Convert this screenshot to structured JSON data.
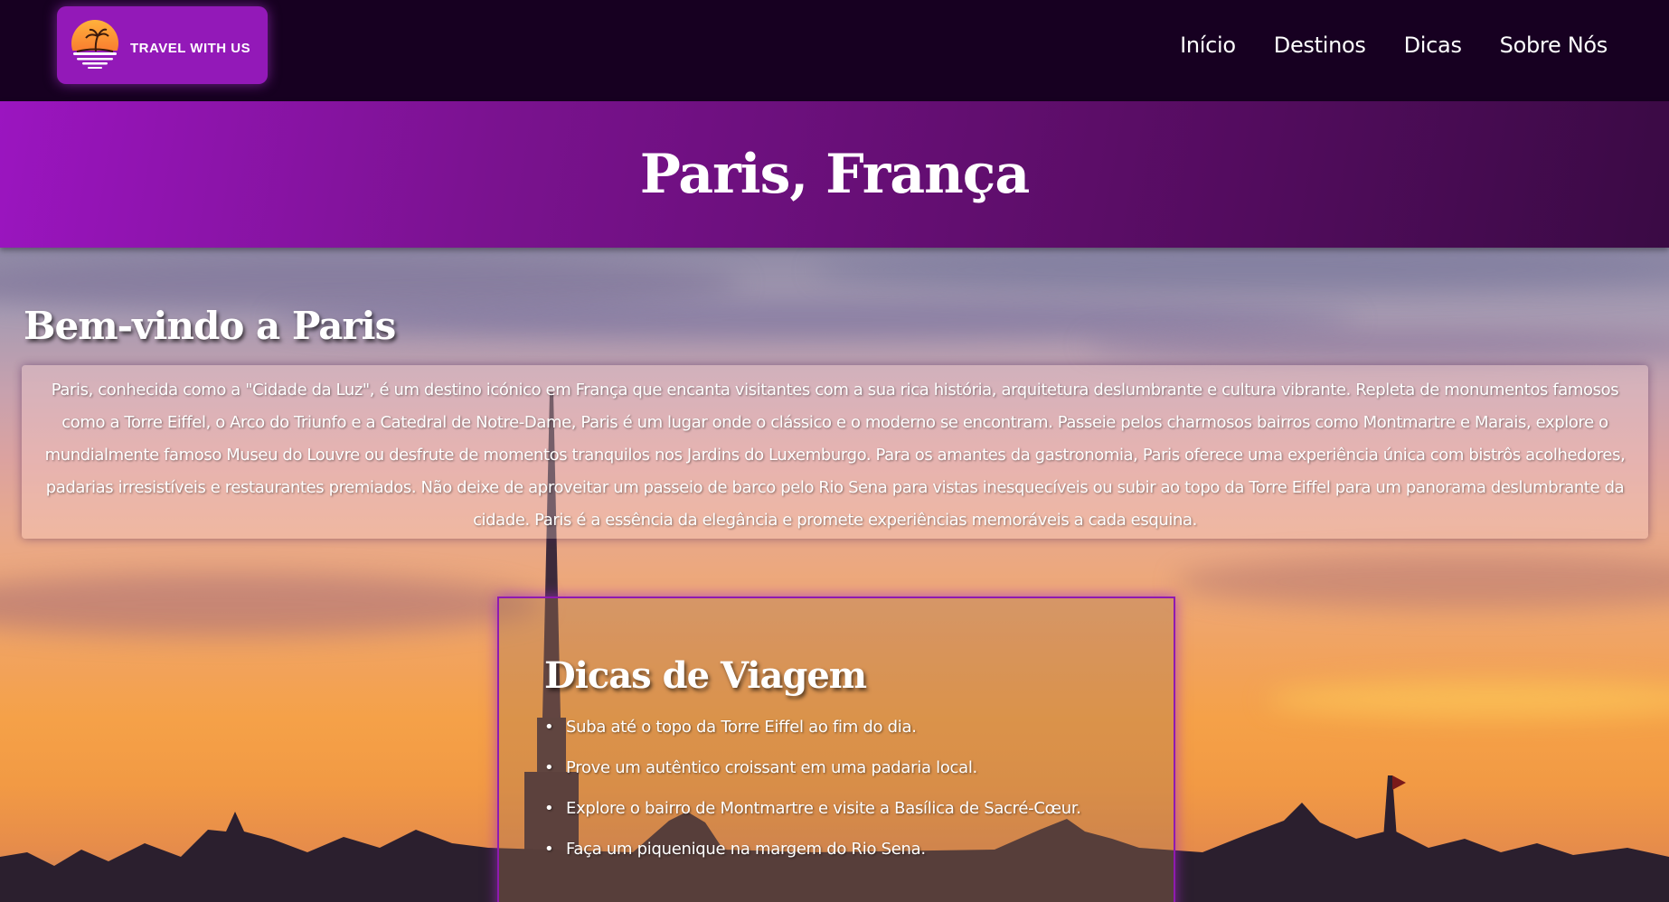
{
  "navbar": {
    "logo_text": "TRAVEL WITH US",
    "links": [
      {
        "label": "Início"
      },
      {
        "label": "Destinos"
      },
      {
        "label": "Dicas"
      },
      {
        "label": "Sobre Nós"
      }
    ]
  },
  "hero": {
    "title": "Paris, França"
  },
  "welcome": {
    "title": "Bem-vindo a Paris",
    "text": "Paris, conhecida como a \"Cidade da Luz\", é um destino icónico em França que encanta visitantes com a sua rica história, arquitetura deslumbrante e cultura vibrante. Repleta de monumentos famosos como a Torre Eiffel, o Arco do Triunfo e a Catedral de Notre-Dame, Paris é um lugar onde o clássico e o moderno se encontram. Passeie pelos charmosos bairros como Montmartre e Marais, explore o mundialmente famoso Museu do Louvre ou desfrute de momentos tranquilos nos Jardins do Luxemburgo. Para os amantes da gastronomia, Paris oferece uma experiência única com bistrôs acolhedores, padarias irresistíveis e restaurantes premiados. Não deixe de aproveitar um passeio de barco pelo Rio Sena para vistas inesquecíveis ou subir ao topo da Torre Eiffel para um panorama deslumbrante da cidade. Paris é a essência da elegância e promete experiências memoráveis a cada esquina."
  },
  "tips": {
    "title": "Dicas de Viagem",
    "items": [
      "Suba até o topo da Torre Eiffel ao fim do dia.",
      "Prove um autêntico croissant em uma padaria local.",
      "Explore o bairro de Montmartre e visite a Basílica de Sacré-Cœur.",
      "Faça um piquenique na margem do Rio Sena."
    ]
  },
  "colors": {
    "navbar_bg": "#170021",
    "logo_bg": "#9319b8",
    "hero_gradient_start": "#9b15c0",
    "hero_gradient_end": "#3a0a44",
    "tips_border": "#8f1ab0"
  },
  "icons": {
    "logo": "sunset-palm-icon",
    "bullet": "bullet-dot-icon"
  }
}
